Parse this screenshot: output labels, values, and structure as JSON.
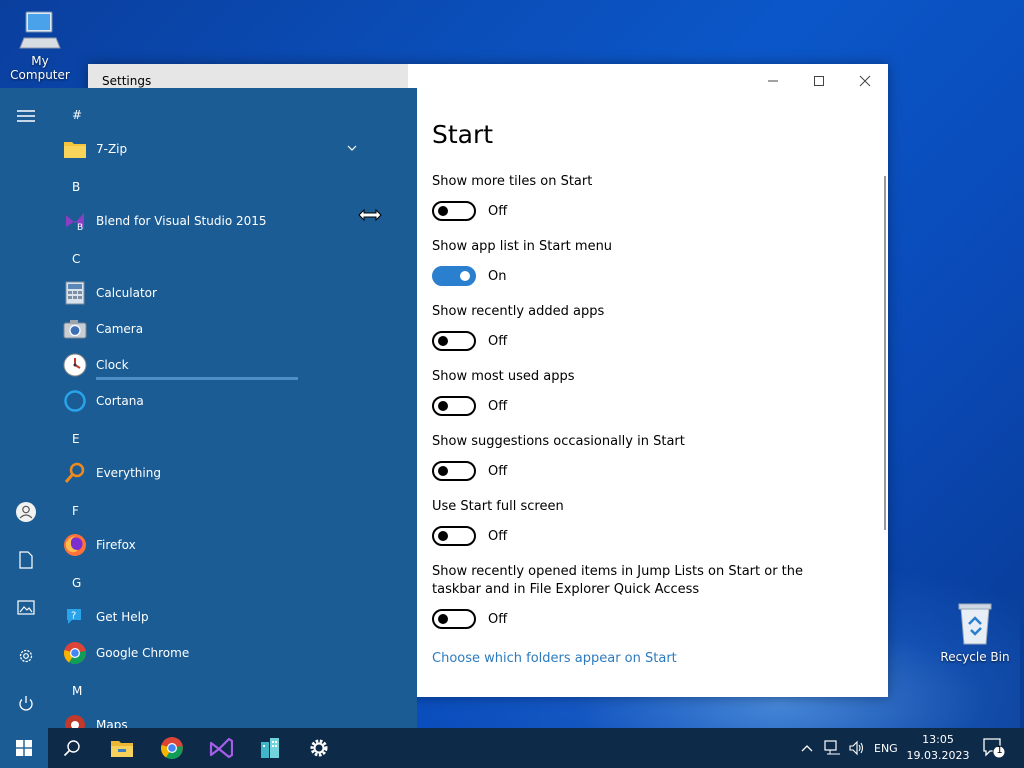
{
  "desktop": {
    "my_computer_label": "My Computer",
    "recycle_bin_label": "Recycle Bin"
  },
  "settings": {
    "window_title": "Settings",
    "page_title": "Start",
    "options": [
      {
        "label": "Show more tiles on Start",
        "state": "Off"
      },
      {
        "label": "Show app list in Start menu",
        "state": "On"
      },
      {
        "label": "Show recently added apps",
        "state": "Off"
      },
      {
        "label": "Show most used apps",
        "state": "Off"
      },
      {
        "label": "Show suggestions occasionally in Start",
        "state": "Off"
      },
      {
        "label": "Use Start full screen",
        "state": "Off"
      },
      {
        "label": "Show recently opened items in Jump Lists on Start or the taskbar and in File Explorer Quick Access",
        "state": "Off"
      }
    ],
    "folders_link": "Choose which folders appear on Start"
  },
  "start_menu": {
    "letters": [
      "#",
      "B",
      "C",
      "E",
      "F",
      "G",
      "M"
    ],
    "apps": [
      {
        "label": "7-Zip",
        "icon": "folder-icon"
      },
      {
        "label": "Blend for Visual Studio 2015",
        "icon": "blend-icon"
      },
      {
        "label": "Calculator",
        "icon": "calculator-icon"
      },
      {
        "label": "Camera",
        "icon": "camera-icon"
      },
      {
        "label": "Clock",
        "icon": "clock-icon"
      },
      {
        "label": "Cortana",
        "icon": "cortana-icon"
      },
      {
        "label": "Everything",
        "icon": "search-magnifier-icon"
      },
      {
        "label": "Firefox",
        "icon": "firefox-icon"
      },
      {
        "label": "Get Help",
        "icon": "help-icon"
      },
      {
        "label": "Google Chrome",
        "icon": "chrome-icon"
      },
      {
        "label": "Maps",
        "icon": "maps-icon"
      }
    ]
  },
  "taskbar": {
    "language": "ENG",
    "time": "13:05",
    "date": "19.03.2023",
    "notification_count": "1"
  },
  "colors": {
    "accent": "#2a7fcf",
    "start_bg": "#1b5c94",
    "taskbar_bg": "#0d2a48",
    "link": "#2d7bbf"
  }
}
